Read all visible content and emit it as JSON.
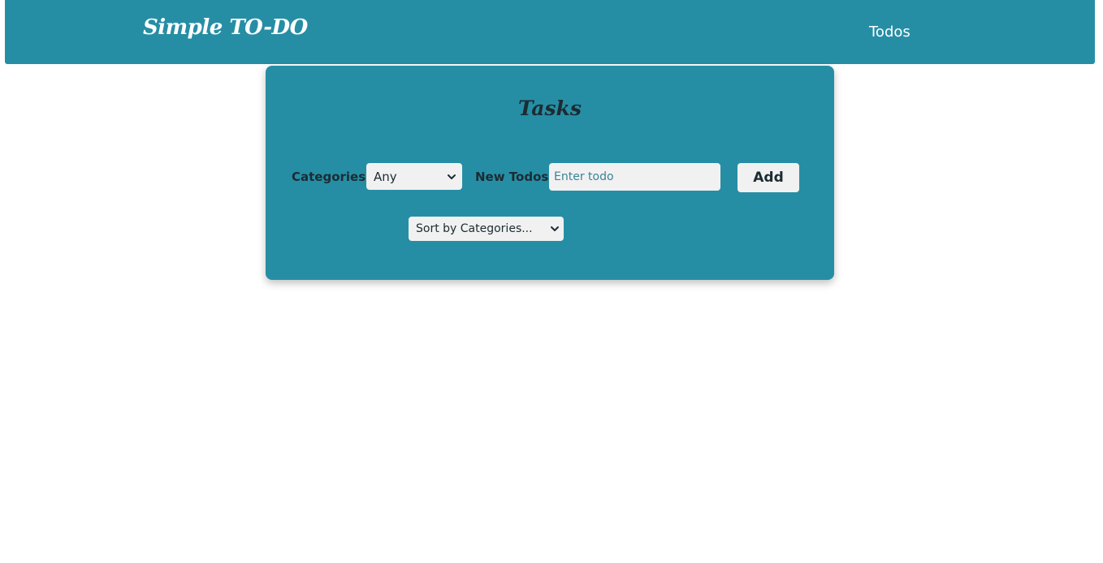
{
  "navbar": {
    "brand": "Simple TO-DO",
    "links": [
      {
        "label": "Todos"
      }
    ]
  },
  "tasks": {
    "title": "Tasks",
    "categories_label": "Categories:",
    "categories_selected": "Any",
    "new_todos_label": "New Todos:",
    "new_todo_placeholder": "Enter todo",
    "add_button": "Add",
    "sort_selected": "Sort by Categories..."
  },
  "colors": {
    "primary": "#268ea4",
    "control_bg": "#f1f1f1",
    "text_dark": "#1c2b33"
  }
}
